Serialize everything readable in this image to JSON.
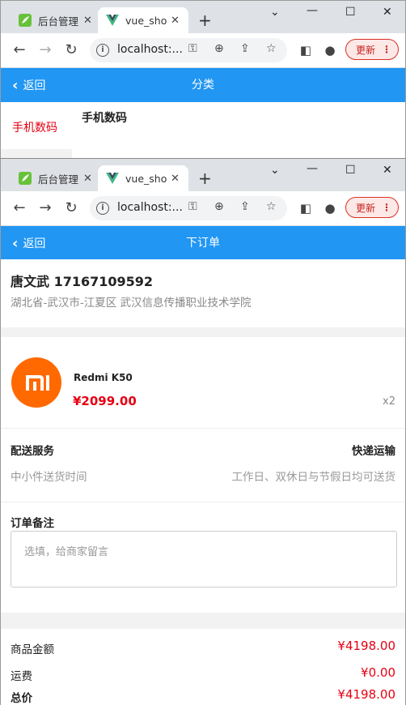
{
  "browser": {
    "tabs": [
      {
        "title": "后台管理",
        "close": "✕"
      },
      {
        "title": "vue_shop",
        "close": "✕"
      }
    ],
    "new_tab": "+",
    "url": "localhost:...",
    "update_label": "更新",
    "menu_dots": "⋮"
  },
  "win1": {
    "appbar": {
      "back_label": "返回",
      "title": "分类"
    },
    "category": {
      "active_item": "手机数码",
      "section_title": "手机数码"
    }
  },
  "win2": {
    "appbar": {
      "back_label": "返回",
      "title": "下订单"
    },
    "address": {
      "name_phone": "唐文武 17167109592",
      "detail": "湖北省-武汉市-江夏区 武汉信息传播职业技术学院"
    },
    "product": {
      "name": "Redmi K50",
      "price": "¥2099.00",
      "quantity": "x2",
      "logo_text": "mi"
    },
    "delivery": {
      "label": "配送服务",
      "value": "快递运输",
      "sub": "中小件送货时间",
      "note": "工作日、双休日与节假日均可送货"
    },
    "remark": {
      "label": "订单备注",
      "placeholder": "选填，给商家留言"
    },
    "summary": {
      "goods_label": "商品金额",
      "goods_value": "¥4198.00",
      "shipping_label": "运费",
      "shipping_value": "¥0.00",
      "total_label": "总价",
      "total_value": "¥4198.00"
    }
  },
  "colors": {
    "appbar": "#2196f3",
    "price": "#e60012",
    "mi_logo": "#ff6900"
  }
}
